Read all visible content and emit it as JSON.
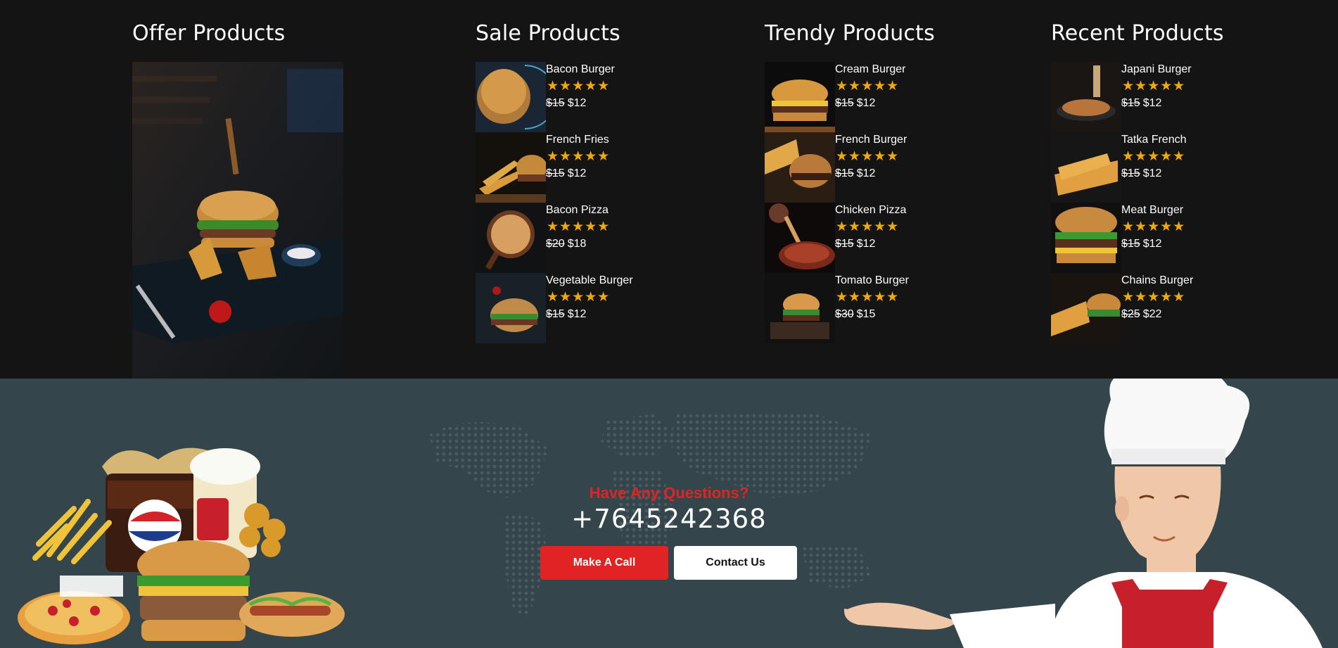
{
  "columns": {
    "offer": {
      "title": "Offer Products"
    },
    "sale": {
      "title": "Sale Products",
      "items": [
        {
          "name": "Bacon Burger",
          "old_price": "$15",
          "price": "$12",
          "stars": "★★★★★"
        },
        {
          "name": "French Fries",
          "old_price": "$15",
          "price": "$12",
          "stars": "★★★★★"
        },
        {
          "name": "Bacon Pizza",
          "old_price": "$20",
          "price": "$18",
          "stars": "★★★★★"
        },
        {
          "name": "Vegetable Burger",
          "old_price": "$15",
          "price": "$12",
          "stars": "★★★★★"
        }
      ]
    },
    "trendy": {
      "title": "Trendy Products",
      "items": [
        {
          "name": "Cream Burger",
          "old_price": "$15",
          "price": "$12",
          "stars": "★★★★★"
        },
        {
          "name": "French Burger",
          "old_price": "$15",
          "price": "$12",
          "stars": "★★★★★"
        },
        {
          "name": "Chicken Pizza",
          "old_price": "$15",
          "price": "$12",
          "stars": "★★★★★"
        },
        {
          "name": "Tomato Burger",
          "old_price": "$30",
          "price": "$15",
          "stars": "★★★★★"
        }
      ]
    },
    "recent": {
      "title": "Recent Products",
      "items": [
        {
          "name": "Japani Burger",
          "old_price": "$15",
          "price": "$12",
          "stars": "★★★★★"
        },
        {
          "name": "Tatka French",
          "old_price": "$15",
          "price": "$12",
          "stars": "★★★★★"
        },
        {
          "name": "Meat Burger",
          "old_price": "$15",
          "price": "$12",
          "stars": "★★★★★"
        },
        {
          "name": "Chains Burger",
          "old_price": "$25",
          "price": "$22",
          "stars": "★★★★★"
        }
      ]
    }
  },
  "cta": {
    "question": "Have Any Questions?",
    "phone": "+7645242368",
    "call_label": "Make A Call",
    "contact_label": "Contact Us"
  },
  "colors": {
    "top_bg": "#141414",
    "bottom_bg": "#34464c",
    "accent_red": "#e02323",
    "star": "#f0a90d"
  },
  "icons": {
    "rating": "star-icon"
  }
}
